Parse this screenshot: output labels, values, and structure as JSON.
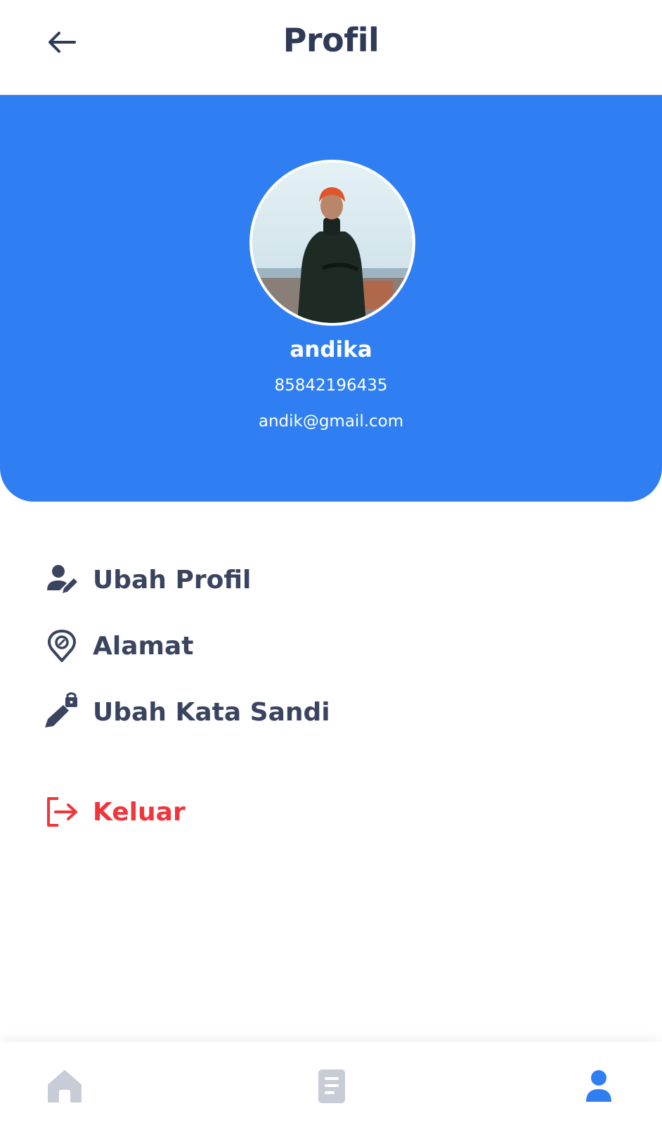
{
  "header": {
    "title": "Profil",
    "back_icon": "arrow-left-icon"
  },
  "profile": {
    "name": "andika",
    "phone": "85842196435",
    "email": "andik@gmail.com",
    "card_color": "#2f7ff3"
  },
  "menu": {
    "items": [
      {
        "label": "Ubah Profil",
        "icon": "user-edit-icon"
      },
      {
        "label": "Alamat",
        "icon": "location-pin-icon"
      },
      {
        "label": "Ubah Kata Sandi",
        "icon": "password-lock-icon"
      }
    ],
    "logout": {
      "label": "Keluar",
      "icon": "logout-icon",
      "color": "#f0353b"
    }
  },
  "bottom_nav": {
    "items": [
      {
        "icon": "home-icon",
        "active": false
      },
      {
        "icon": "document-icon",
        "active": false
      },
      {
        "icon": "user-icon",
        "active": true
      }
    ],
    "active_color": "#2f7ff3",
    "inactive_color": "#c7ccd6"
  }
}
